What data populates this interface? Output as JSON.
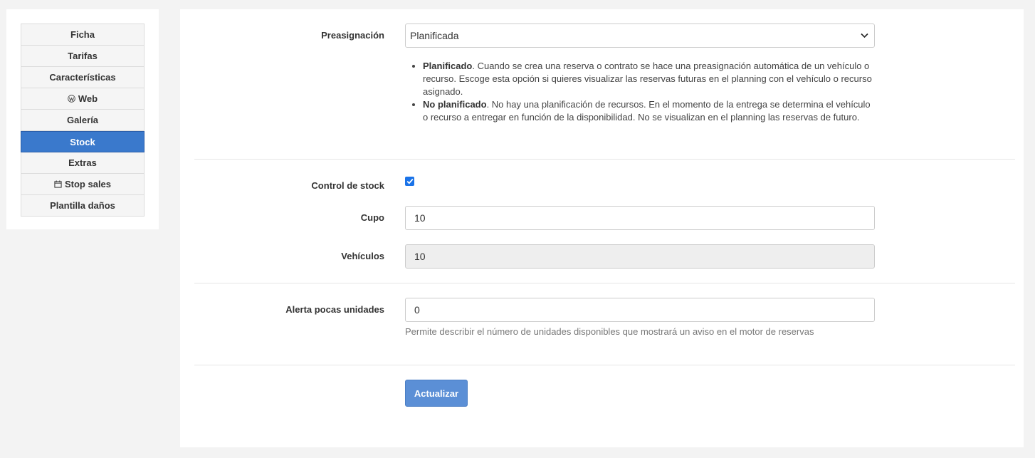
{
  "sidebar": {
    "items": [
      {
        "label": "Ficha",
        "icon": ""
      },
      {
        "label": "Tarifas",
        "icon": ""
      },
      {
        "label": "Características",
        "icon": ""
      },
      {
        "label": "Web",
        "icon": "wordpress-icon"
      },
      {
        "label": "Galería",
        "icon": ""
      },
      {
        "label": "Stock",
        "icon": "",
        "active": true
      },
      {
        "label": "Extras",
        "icon": ""
      },
      {
        "label": "Stop sales",
        "icon": "calendar-icon"
      },
      {
        "label": "Plantilla daños",
        "icon": ""
      }
    ],
    "active_color": "#3a79cc"
  },
  "form": {
    "preassignment": {
      "label": "Preasignación",
      "value": "Planificada",
      "help": [
        {
          "bold": "Planificado",
          "text": ". Cuando se crea una reserva o contrato se hace una preasignación automática de un vehículo o recurso. Escoge esta opción si quieres visualizar las reservas futuras en el planning con el vehículo o recurso asignado."
        },
        {
          "bold": "No planificado",
          "text": ". No hay una planificación de recursos. En el momento de la entrega se determina el vehículo o recurso a entregar en función de la disponibilidad. No se visualizan en el planning las reservas de futuro."
        }
      ]
    },
    "stock_control": {
      "label": "Control de stock",
      "checked": true
    },
    "quota": {
      "label": "Cupo",
      "value": "10"
    },
    "vehicles": {
      "label": "Vehículos",
      "value": "10"
    },
    "low_units_alert": {
      "label": "Alerta pocas unidades",
      "value": "0",
      "help": "Permite describir el número de unidades disponibles que mostrará un aviso en el motor de reservas"
    },
    "submit_label": "Actualizar"
  }
}
